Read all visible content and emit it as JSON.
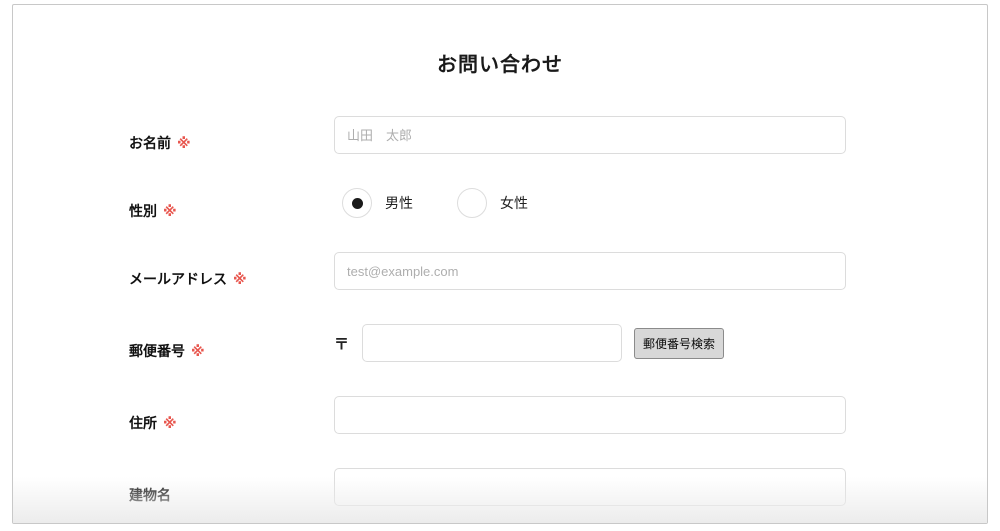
{
  "page": {
    "title": "お問い合わせ"
  },
  "form": {
    "required_mark": "※",
    "fields": {
      "name": {
        "label": "お名前",
        "required": true,
        "placeholder": "山田　太郎",
        "value": ""
      },
      "gender": {
        "label": "性別",
        "required": true,
        "options": [
          {
            "label": "男性",
            "selected": true
          },
          {
            "label": "女性",
            "selected": false
          }
        ]
      },
      "email": {
        "label": "メールアドレス",
        "required": true,
        "placeholder": "test@example.com",
        "value": ""
      },
      "postal": {
        "label": "郵便番号",
        "required": true,
        "prefix": "〒",
        "value": "",
        "search_button_label": "郵便番号検索"
      },
      "address": {
        "label": "住所",
        "required": true,
        "value": ""
      },
      "building": {
        "label": "建物名",
        "required": false,
        "value": ""
      }
    }
  },
  "colors": {
    "required_mark": "#e8564e",
    "card_border": "#c8c8c8",
    "button_bg": "#d8d8d8"
  }
}
